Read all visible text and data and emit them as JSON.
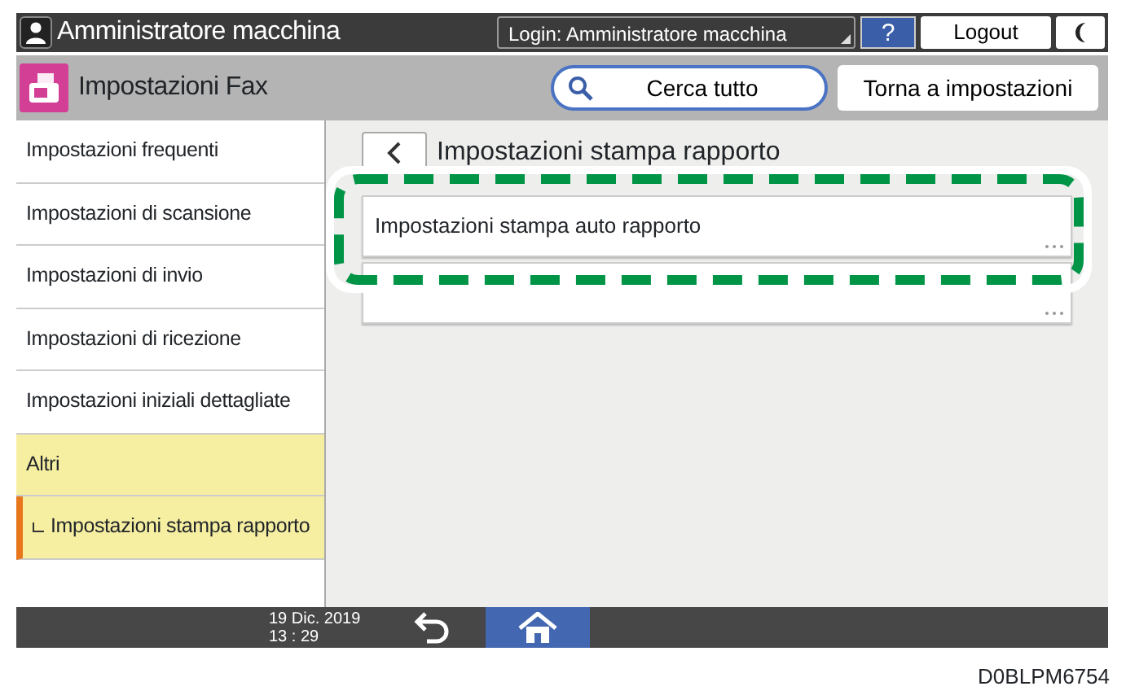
{
  "top_bar": {
    "user": "Amministratore macchina",
    "login": "Login: Amministratore macchina",
    "help": "?",
    "logout": "Logout"
  },
  "header": {
    "title": "Impostazioni Fax",
    "search": "Cerca tutto",
    "back_to_settings": "Torna a impostazioni"
  },
  "sidebar": {
    "items": [
      {
        "label": "Impostazioni frequenti",
        "selected": false,
        "expanded": false
      },
      {
        "label": "Impostazioni di scansione",
        "selected": false,
        "expanded": false
      },
      {
        "label": "Impostazioni di invio",
        "selected": false,
        "expanded": false
      },
      {
        "label": "Impostazioni di ricezione",
        "selected": false,
        "expanded": false
      },
      {
        "label": "Impostazioni iniziali dettagliate",
        "selected": false,
        "expanded": false
      },
      {
        "label": "Altri",
        "selected": false,
        "expanded": true,
        "children": [
          {
            "label": "Impostazioni stampa rapporto",
            "selected": true
          }
        ]
      }
    ]
  },
  "content": {
    "title": "Impostazioni stampa rapporto",
    "cards": [
      {
        "label": "Impostazioni stampa auto rapporto",
        "highlighted": true
      },
      {
        "highlighted": false
      }
    ]
  },
  "status_bar": {
    "date": "19 Dic. 2019",
    "time": "13 : 29"
  },
  "caption": "D0BLPM6754"
}
